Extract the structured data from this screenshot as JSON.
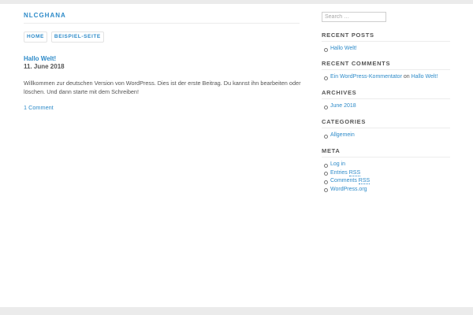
{
  "site": {
    "title": "NLCGHANA"
  },
  "nav": {
    "items": [
      {
        "label": "HOME"
      },
      {
        "label": "BEISPIEL-SEITE"
      }
    ]
  },
  "post": {
    "title": "Hallo Welt!",
    "date": "11. June 2018",
    "body": "Willkommen zur deutschen Version von WordPress. Dies ist der erste Beitrag. Du kannst ihn bearbeiten oder löschen. Und dann starte mit dem Schreiben!",
    "comments_link": "1 Comment"
  },
  "sidebar": {
    "search": {
      "placeholder": "Search …"
    },
    "recent_posts": {
      "title": "RECENT POSTS",
      "items": [
        {
          "label": "Hallo Welt!"
        }
      ]
    },
    "recent_comments": {
      "title": "RECENT COMMENTS",
      "items": [
        {
          "author": "Ein WordPress-Kommentator",
          "on": "on",
          "post": "Hallo Welt!"
        }
      ]
    },
    "archives": {
      "title": "ARCHIVES",
      "items": [
        {
          "label": "June 2018"
        }
      ]
    },
    "categories": {
      "title": "CATEGORIES",
      "items": [
        {
          "label": "Allgemein"
        }
      ]
    },
    "meta": {
      "title": "META",
      "items": [
        {
          "label": "Log in"
        },
        {
          "label_prefix": "Entries",
          "abbr": "RSS"
        },
        {
          "label_prefix": "Comments",
          "abbr": "RSS"
        },
        {
          "label": "WordPress.org"
        }
      ]
    }
  }
}
